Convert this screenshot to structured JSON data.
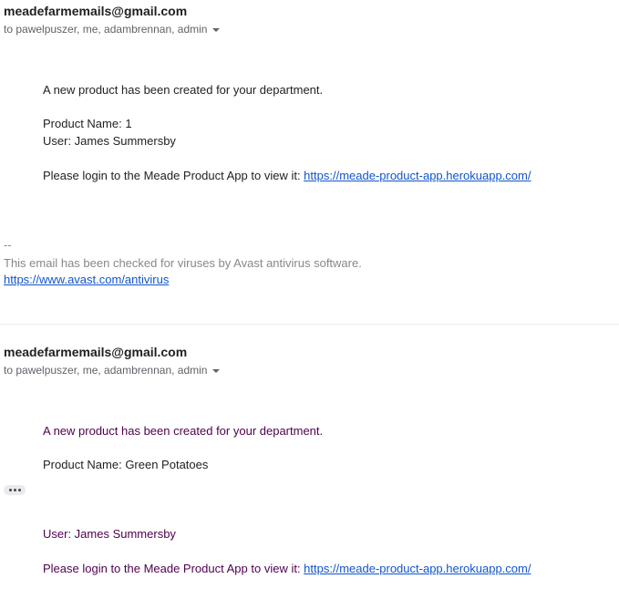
{
  "messages": [
    {
      "sender": "meadefarmemails@gmail.com",
      "recipients": "to pawelpuszer, me, adambrennan, admin",
      "body": {
        "intro": "A new product has been created for your department.",
        "product_name": "Product Name: 1",
        "user": "User: James Summersby",
        "login_text": "Please login to the Meade Product App to view it: ",
        "login_link": "https://meade-product-app.herokuapp.com/"
      },
      "signature": {
        "dashes": "--",
        "text": "This email has been checked for viruses by Avast antivirus software.",
        "link": "https://www.avast.com/antivirus"
      }
    },
    {
      "sender": "meadefarmemails@gmail.com",
      "recipients": "to pawelpuszer, me, adambrennan, admin",
      "body": {
        "intro": "A new product has been created for your department.",
        "product_name": "Product Name: Green Potatoes",
        "user": "User: James Summersby",
        "login_text": "Please login to the Meade Product App to view it: ",
        "login_link": "https://meade-product-app.herokuapp.com/"
      }
    }
  ],
  "icons": {
    "recipients_caret": "chevron-down-icon",
    "trimmed_content": "more-horizontal-icon"
  },
  "colors": {
    "link": "#1155cc",
    "quoted_text": "#500050",
    "signature_text": "#888888",
    "recipient_text": "#5f6368"
  }
}
